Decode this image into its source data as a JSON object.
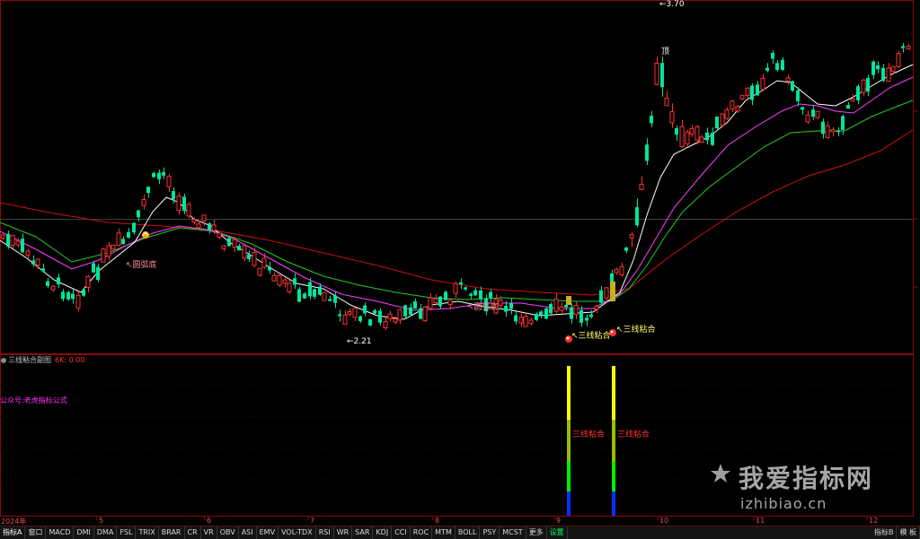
{
  "main_chart": {
    "annotations": {
      "arc_bottom_1": "↖圆弧底",
      "arc_bottom_2": "↖圆弧底",
      "low_price": "←2.21",
      "high_price": "←3.70",
      "top_marker": "顶",
      "three_line_1": "↖三线粘合",
      "three_line_2": "↖三线粘合"
    }
  },
  "sub_panel": {
    "title": "三线粘合副图",
    "value_text": "6K: 0.00",
    "formula_label": "公众号:老虎指标公式",
    "signal_label_1": "三线粘合",
    "signal_label_2": "三线粘合"
  },
  "x_axis": {
    "labels": [
      "2024年",
      "5",
      "6",
      "7",
      "8",
      "9",
      "10",
      "11",
      "12"
    ]
  },
  "tabs": {
    "items": [
      "指标A",
      "窗口",
      "MACD",
      "DMI",
      "DMA",
      "FSL",
      "TRIX",
      "BRAR",
      "CR",
      "VR",
      "OBV",
      "ASI",
      "EMV",
      "VOL-TDX",
      "RSI",
      "WR",
      "SAR",
      "KDJ",
      "CCI",
      "ROC",
      "MTM",
      "BOLL",
      "PSY",
      "MCST",
      "更多",
      "设置"
    ],
    "right_items": [
      "指标B",
      "模 板"
    ]
  },
  "watermark": {
    "title": "我爱指标网",
    "url": "izhibiao.cn",
    "icon": "star-icon"
  },
  "colors": {
    "up": "#ff3030",
    "down": "#00e5a0",
    "ma_white": "#ffffff",
    "ma_magenta": "#ff40ff",
    "ma_green": "#22cc22",
    "ma_red": "#cc1010",
    "frame": "#8a0a0a"
  }
}
